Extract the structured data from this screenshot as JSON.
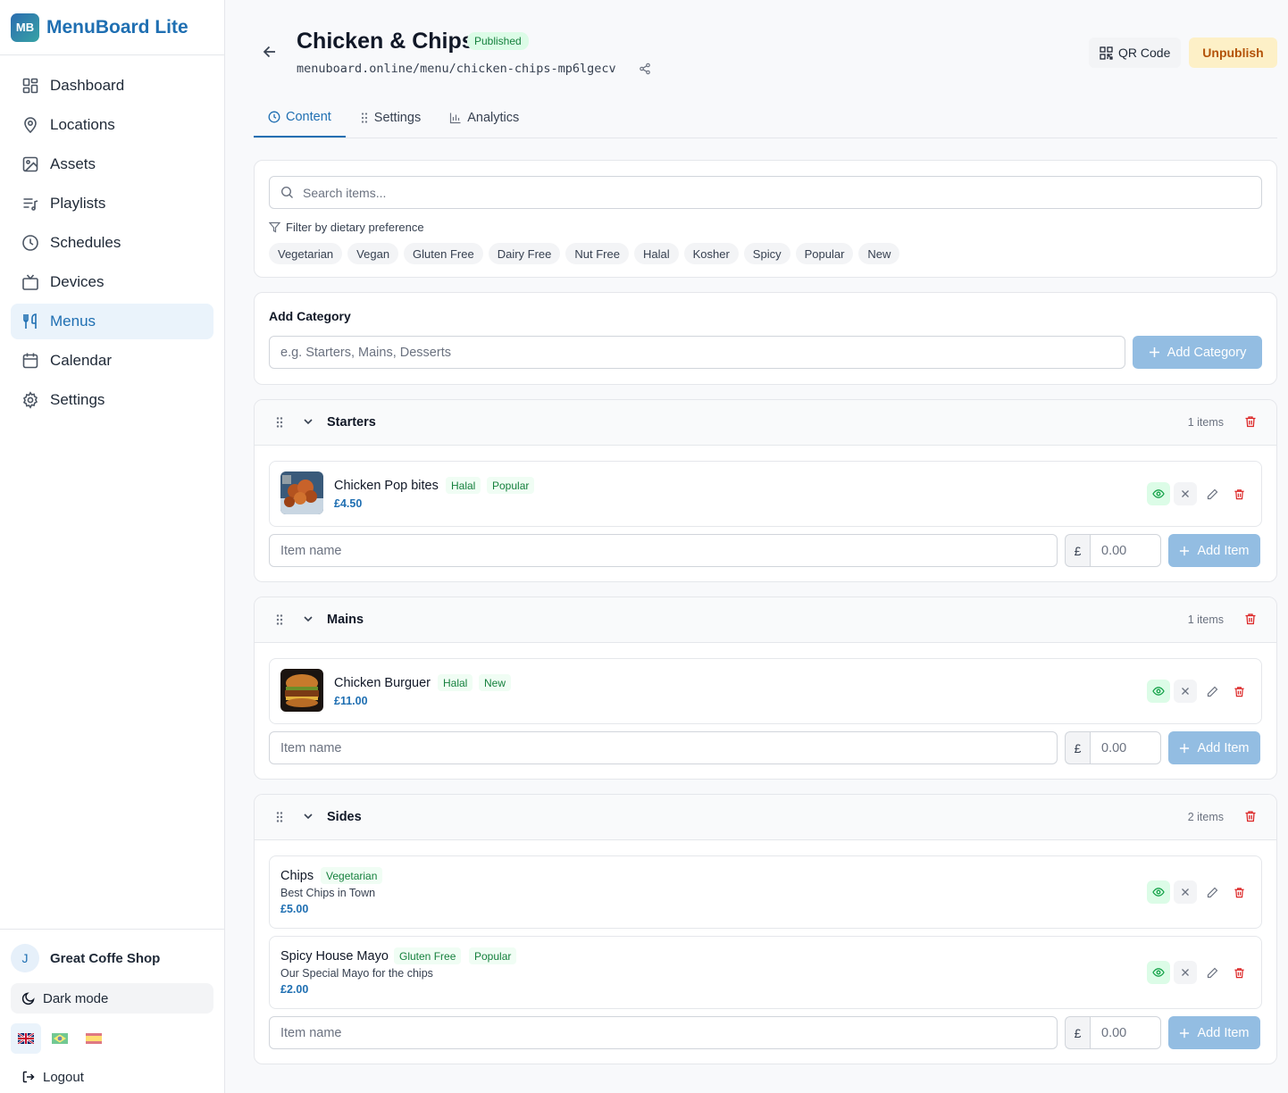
{
  "brand": {
    "logo": "MB",
    "name": "MenuBoard Lite"
  },
  "nav": [
    {
      "label": "Dashboard",
      "icon": "dashboard-icon"
    },
    {
      "label": "Locations",
      "icon": "map-pin-icon"
    },
    {
      "label": "Assets",
      "icon": "image-icon"
    },
    {
      "label": "Playlists",
      "icon": "playlist-icon"
    },
    {
      "label": "Schedules",
      "icon": "clock-icon"
    },
    {
      "label": "Devices",
      "icon": "tv-icon"
    },
    {
      "label": "Menus",
      "icon": "utensils-icon",
      "active": true
    },
    {
      "label": "Calendar",
      "icon": "calendar-icon"
    },
    {
      "label": "Settings",
      "icon": "gear-icon"
    }
  ],
  "user": {
    "initial": "J",
    "name": "Great Coffe Shop"
  },
  "dark_mode_label": "Dark mode",
  "logout_label": "Logout",
  "languages": [
    "en-GB",
    "pt-BR",
    "es-ES"
  ],
  "page": {
    "title": "Chicken & Chips",
    "status": "Published",
    "url": "menuboard.online/menu/chicken-chips-mp6lgecv",
    "qr_label": "QR Code",
    "unpublish_label": "Unpublish"
  },
  "tabs": [
    {
      "label": "Content",
      "active": true
    },
    {
      "label": "Settings"
    },
    {
      "label": "Analytics"
    }
  ],
  "search": {
    "placeholder": "Search items...",
    "filter_label": "Filter by dietary preference",
    "chips": [
      "Vegetarian",
      "Vegan",
      "Gluten Free",
      "Dairy Free",
      "Nut Free",
      "Halal",
      "Kosher",
      "Spicy",
      "Popular",
      "New"
    ]
  },
  "add_category": {
    "title": "Add Category",
    "placeholder": "e.g. Starters, Mains, Desserts",
    "button": "Add Category"
  },
  "add_item": {
    "placeholder": "Item name",
    "currency": "£",
    "price_placeholder": "0.00",
    "button": "Add Item"
  },
  "categories": [
    {
      "name": "Starters",
      "count": "1 items",
      "items": [
        {
          "name": "Chicken Pop bites",
          "tags": [
            "Halal",
            "Popular"
          ],
          "price": "£4.50"
        }
      ]
    },
    {
      "name": "Mains",
      "count": "1 items",
      "items": [
        {
          "name": "Chicken Burguer",
          "tags": [
            "Halal",
            "New"
          ],
          "price": "£11.00"
        }
      ]
    },
    {
      "name": "Sides",
      "count": "2 items",
      "items": [
        {
          "name": "Chips",
          "tags": [
            "Vegetarian"
          ],
          "description": "Best Chips in Town",
          "price": "£5.00"
        },
        {
          "name": "Spicy House Mayo",
          "tags": [
            "Gluten Free",
            "Popular"
          ],
          "description": "Our Special Mayo for the chips",
          "price": "£2.00"
        }
      ]
    }
  ]
}
